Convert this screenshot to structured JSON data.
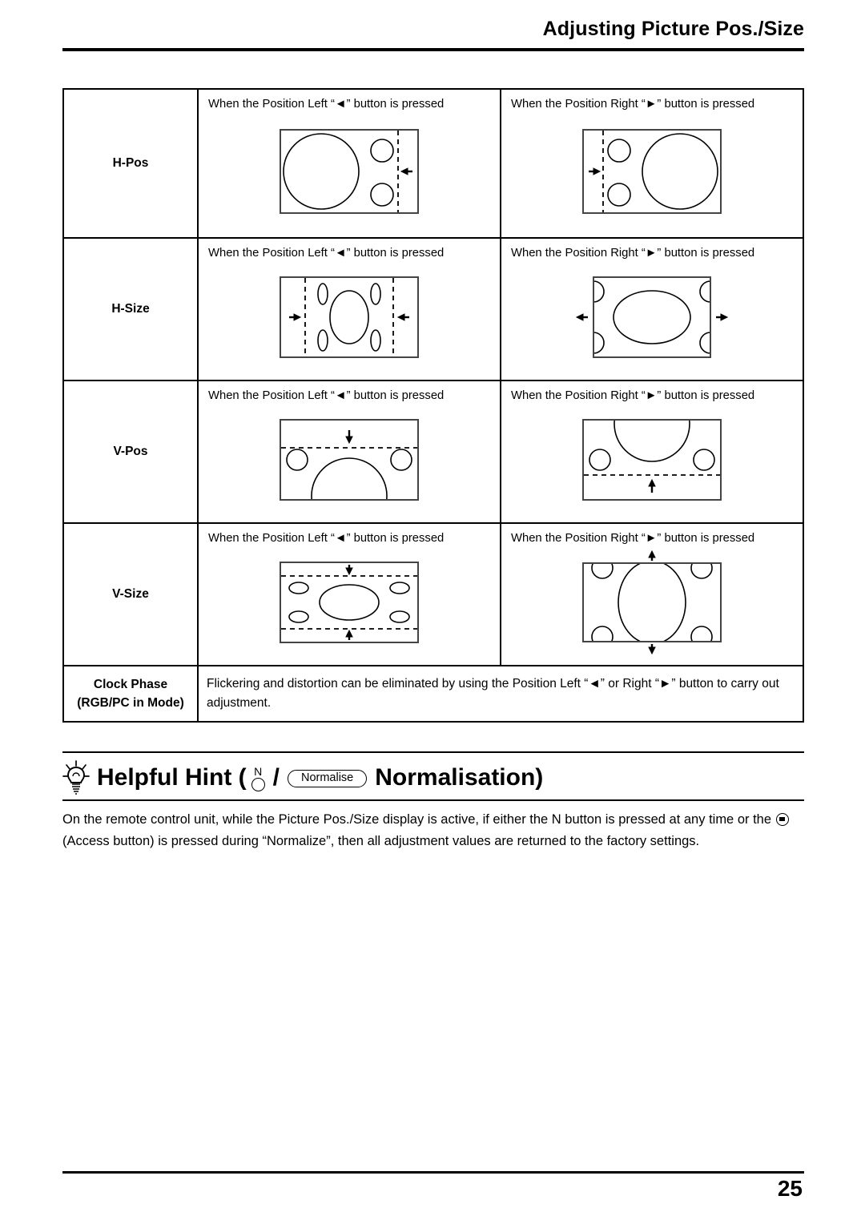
{
  "header": {
    "title": "Adjusting Picture Pos./Size"
  },
  "table": {
    "caption_left": "When the Position Left “◄” button is pressed",
    "caption_right": "When the Position Right “►” button is pressed",
    "rows": [
      {
        "label": "H-Pos",
        "left_caption": "When the Position Left “◄” button is pressed",
        "right_caption": "When the Position Right “►” button is pressed",
        "left_effect": "image shifts left, dashed guide near right edge with left arrow",
        "right_effect": "image shifts right, dashed guide near left edge with right arrow"
      },
      {
        "label": "H-Size",
        "left_caption": "When the Position Left “◄” button is pressed",
        "right_caption": "When the Position Right “►” button is pressed",
        "left_effect": "image narrows horizontally, dashed guides inset with inward arrows",
        "right_effect": "image widens horizontally, outward arrows at both sides"
      },
      {
        "label": "V-Pos",
        "left_caption": "When the Position Left “◄” button is pressed",
        "right_caption": "When the Position Right “►” button is pressed",
        "left_effect": "image shifts down, dashed guide near top with down arrow",
        "right_effect": "image shifts up, dashed guide near bottom with up arrow"
      },
      {
        "label": "V-Size",
        "left_caption": "When the Position Left “◄” button is pressed",
        "right_caption": "When the Position Right “►” button is pressed",
        "left_effect": "image shortens vertically, dashed guides inset with inward arrows",
        "right_effect": "image stretches vertically, outward arrows above and below"
      }
    ],
    "clock_phase": {
      "label_line1": "Clock Phase",
      "label_line2": "(RGB/PC in Mode)",
      "text": "Flickering and distortion can be eliminated by using the Position Left “◄” or Right “►” button to carry out adjustment."
    }
  },
  "hint": {
    "icon": "lightbulb-icon",
    "title_prefix": "Helpful Hint (",
    "n_button_label": "N",
    "separator": "/",
    "pill_label": "Normalise",
    "title_suffix": "Normalisation)",
    "body_part1": "On the remote control unit, while the Picture Pos./Size display is active, if either the N button is pressed at any time or the ",
    "body_part2": " (Access button) is pressed during “Normalize”, then all adjustment values are returned to the factory settings."
  },
  "footer": {
    "page_number": "25"
  },
  "colors": {
    "text": "#000000",
    "page_background": "#ffffff",
    "frame_stroke": "#444444"
  }
}
